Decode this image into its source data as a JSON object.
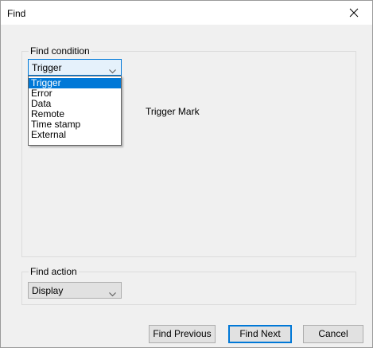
{
  "window": {
    "title": "Find",
    "close_icon": "close-icon"
  },
  "find_condition": {
    "legend": "Find condition",
    "selected": "Trigger",
    "options": [
      "Trigger",
      "Error",
      "Data",
      "Remote",
      "Time stamp",
      "External"
    ],
    "detail_label": "Trigger Mark"
  },
  "find_action": {
    "legend": "Find action",
    "selected": "Display"
  },
  "buttons": {
    "find_previous": "Find Previous",
    "find_next": "Find Next",
    "cancel": "Cancel"
  },
  "colors": {
    "accent": "#0078d7",
    "window_bg": "#f0f0f0",
    "button_bg": "#e1e1e1"
  }
}
